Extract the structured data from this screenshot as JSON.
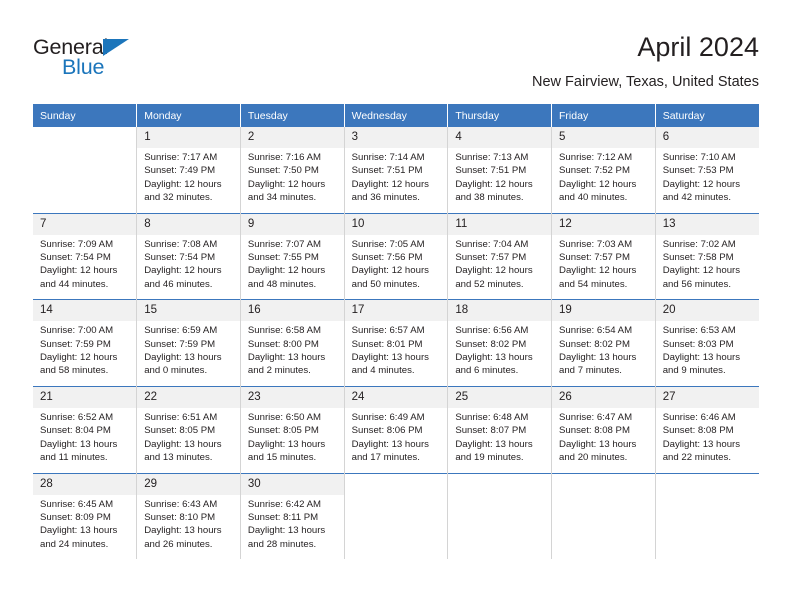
{
  "brand": {
    "name_dark": "General",
    "name_blue": "Blue",
    "accent_color": "#1b75bb"
  },
  "header": {
    "title": "April 2024",
    "subtitle": "New Fairview, Texas, United States"
  },
  "colors": {
    "header_bar": "#3c77bd",
    "daynum_band": "#f1f1f1",
    "text": "#231f20",
    "cell_divider": "#d4d4d4"
  },
  "weekdays": [
    "Sunday",
    "Monday",
    "Tuesday",
    "Wednesday",
    "Thursday",
    "Friday",
    "Saturday"
  ],
  "labels": {
    "sunrise": "Sunrise:",
    "sunset": "Sunset:",
    "daylight": "Daylight:"
  },
  "weeks": [
    [
      {
        "day": ""
      },
      {
        "day": "1",
        "sunrise": "Sunrise: 7:17 AM",
        "sunset": "Sunset: 7:49 PM",
        "daylight1": "Daylight: 12 hours",
        "daylight2": "and 32 minutes."
      },
      {
        "day": "2",
        "sunrise": "Sunrise: 7:16 AM",
        "sunset": "Sunset: 7:50 PM",
        "daylight1": "Daylight: 12 hours",
        "daylight2": "and 34 minutes."
      },
      {
        "day": "3",
        "sunrise": "Sunrise: 7:14 AM",
        "sunset": "Sunset: 7:51 PM",
        "daylight1": "Daylight: 12 hours",
        "daylight2": "and 36 minutes."
      },
      {
        "day": "4",
        "sunrise": "Sunrise: 7:13 AM",
        "sunset": "Sunset: 7:51 PM",
        "daylight1": "Daylight: 12 hours",
        "daylight2": "and 38 minutes."
      },
      {
        "day": "5",
        "sunrise": "Sunrise: 7:12 AM",
        "sunset": "Sunset: 7:52 PM",
        "daylight1": "Daylight: 12 hours",
        "daylight2": "and 40 minutes."
      },
      {
        "day": "6",
        "sunrise": "Sunrise: 7:10 AM",
        "sunset": "Sunset: 7:53 PM",
        "daylight1": "Daylight: 12 hours",
        "daylight2": "and 42 minutes."
      }
    ],
    [
      {
        "day": "7",
        "sunrise": "Sunrise: 7:09 AM",
        "sunset": "Sunset: 7:54 PM",
        "daylight1": "Daylight: 12 hours",
        "daylight2": "and 44 minutes."
      },
      {
        "day": "8",
        "sunrise": "Sunrise: 7:08 AM",
        "sunset": "Sunset: 7:54 PM",
        "daylight1": "Daylight: 12 hours",
        "daylight2": "and 46 minutes."
      },
      {
        "day": "9",
        "sunrise": "Sunrise: 7:07 AM",
        "sunset": "Sunset: 7:55 PM",
        "daylight1": "Daylight: 12 hours",
        "daylight2": "and 48 minutes."
      },
      {
        "day": "10",
        "sunrise": "Sunrise: 7:05 AM",
        "sunset": "Sunset: 7:56 PM",
        "daylight1": "Daylight: 12 hours",
        "daylight2": "and 50 minutes."
      },
      {
        "day": "11",
        "sunrise": "Sunrise: 7:04 AM",
        "sunset": "Sunset: 7:57 PM",
        "daylight1": "Daylight: 12 hours",
        "daylight2": "and 52 minutes."
      },
      {
        "day": "12",
        "sunrise": "Sunrise: 7:03 AM",
        "sunset": "Sunset: 7:57 PM",
        "daylight1": "Daylight: 12 hours",
        "daylight2": "and 54 minutes."
      },
      {
        "day": "13",
        "sunrise": "Sunrise: 7:02 AM",
        "sunset": "Sunset: 7:58 PM",
        "daylight1": "Daylight: 12 hours",
        "daylight2": "and 56 minutes."
      }
    ],
    [
      {
        "day": "14",
        "sunrise": "Sunrise: 7:00 AM",
        "sunset": "Sunset: 7:59 PM",
        "daylight1": "Daylight: 12 hours",
        "daylight2": "and 58 minutes."
      },
      {
        "day": "15",
        "sunrise": "Sunrise: 6:59 AM",
        "sunset": "Sunset: 7:59 PM",
        "daylight1": "Daylight: 13 hours",
        "daylight2": "and 0 minutes."
      },
      {
        "day": "16",
        "sunrise": "Sunrise: 6:58 AM",
        "sunset": "Sunset: 8:00 PM",
        "daylight1": "Daylight: 13 hours",
        "daylight2": "and 2 minutes."
      },
      {
        "day": "17",
        "sunrise": "Sunrise: 6:57 AM",
        "sunset": "Sunset: 8:01 PM",
        "daylight1": "Daylight: 13 hours",
        "daylight2": "and 4 minutes."
      },
      {
        "day": "18",
        "sunrise": "Sunrise: 6:56 AM",
        "sunset": "Sunset: 8:02 PM",
        "daylight1": "Daylight: 13 hours",
        "daylight2": "and 6 minutes."
      },
      {
        "day": "19",
        "sunrise": "Sunrise: 6:54 AM",
        "sunset": "Sunset: 8:02 PM",
        "daylight1": "Daylight: 13 hours",
        "daylight2": "and 7 minutes."
      },
      {
        "day": "20",
        "sunrise": "Sunrise: 6:53 AM",
        "sunset": "Sunset: 8:03 PM",
        "daylight1": "Daylight: 13 hours",
        "daylight2": "and 9 minutes."
      }
    ],
    [
      {
        "day": "21",
        "sunrise": "Sunrise: 6:52 AM",
        "sunset": "Sunset: 8:04 PM",
        "daylight1": "Daylight: 13 hours",
        "daylight2": "and 11 minutes."
      },
      {
        "day": "22",
        "sunrise": "Sunrise: 6:51 AM",
        "sunset": "Sunset: 8:05 PM",
        "daylight1": "Daylight: 13 hours",
        "daylight2": "and 13 minutes."
      },
      {
        "day": "23",
        "sunrise": "Sunrise: 6:50 AM",
        "sunset": "Sunset: 8:05 PM",
        "daylight1": "Daylight: 13 hours",
        "daylight2": "and 15 minutes."
      },
      {
        "day": "24",
        "sunrise": "Sunrise: 6:49 AM",
        "sunset": "Sunset: 8:06 PM",
        "daylight1": "Daylight: 13 hours",
        "daylight2": "and 17 minutes."
      },
      {
        "day": "25",
        "sunrise": "Sunrise: 6:48 AM",
        "sunset": "Sunset: 8:07 PM",
        "daylight1": "Daylight: 13 hours",
        "daylight2": "and 19 minutes."
      },
      {
        "day": "26",
        "sunrise": "Sunrise: 6:47 AM",
        "sunset": "Sunset: 8:08 PM",
        "daylight1": "Daylight: 13 hours",
        "daylight2": "and 20 minutes."
      },
      {
        "day": "27",
        "sunrise": "Sunrise: 6:46 AM",
        "sunset": "Sunset: 8:08 PM",
        "daylight1": "Daylight: 13 hours",
        "daylight2": "and 22 minutes."
      }
    ],
    [
      {
        "day": "28",
        "sunrise": "Sunrise: 6:45 AM",
        "sunset": "Sunset: 8:09 PM",
        "daylight1": "Daylight: 13 hours",
        "daylight2": "and 24 minutes."
      },
      {
        "day": "29",
        "sunrise": "Sunrise: 6:43 AM",
        "sunset": "Sunset: 8:10 PM",
        "daylight1": "Daylight: 13 hours",
        "daylight2": "and 26 minutes."
      },
      {
        "day": "30",
        "sunrise": "Sunrise: 6:42 AM",
        "sunset": "Sunset: 8:11 PM",
        "daylight1": "Daylight: 13 hours",
        "daylight2": "and 28 minutes."
      },
      {
        "day": ""
      },
      {
        "day": ""
      },
      {
        "day": ""
      },
      {
        "day": ""
      }
    ]
  ]
}
